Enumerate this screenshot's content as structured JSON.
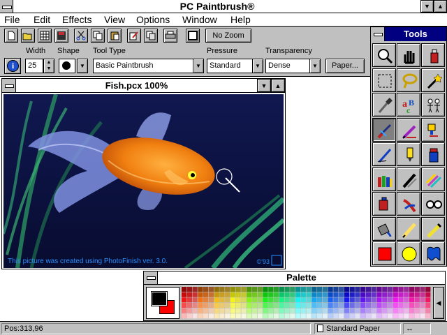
{
  "app": {
    "title": "PC Paintbrush®"
  },
  "menu": [
    "File",
    "Edit",
    "Effects",
    "View",
    "Options",
    "Window",
    "Help"
  ],
  "toolbar": {
    "buttons": [
      "new-icon",
      "open-icon",
      "grid-icon",
      "save-icon",
      "cut-icon",
      "copy-icon",
      "paste-icon",
      "edit-icon",
      "clipboard-icon",
      "print-icon",
      "frame-icon"
    ],
    "zoom_label": "No Zoom"
  },
  "options": {
    "width_label": "Width",
    "width_value": "25",
    "shape_label": "Shape",
    "tooltype_label": "Tool Type",
    "tooltype_value": "Basic Paintbrush",
    "pressure_label": "Pressure",
    "pressure_value": "Standard",
    "transparency_label": "Transparency",
    "transparency_value": "Dense",
    "paper_label": "Paper..."
  },
  "document": {
    "title": "Fish.pcx  100%",
    "credit": "This picture was created using PhotoFinish ver. 3.0.",
    "copyright": "©'93"
  },
  "tools": {
    "title": "Tools",
    "items": [
      "zoom-icon",
      "hand-icon",
      "spray-paint-icon",
      "marquee-icon",
      "lasso-icon",
      "magic-wand-icon",
      "eyedropper-icon",
      "text-icon",
      "clone-icon",
      "paintbrush-icon",
      "pencil-icon",
      "airbrush-icon",
      "pen-icon",
      "highlighter-icon",
      "paint-can-icon",
      "crayons-icon",
      "line-icon",
      "multi-pen-icon",
      "color-replace-icon",
      "smudge-icon",
      "glasses-icon",
      "fill-bucket-icon",
      "chalk-icon",
      "marker-icon",
      "rectangle-icon",
      "ellipse-icon",
      "freeform-shape-icon"
    ]
  },
  "palette": {
    "title": "Palette",
    "foreground": "#000000",
    "background": "#ff0000"
  },
  "status": {
    "position": "Pos:313,96",
    "paper": "Standard Paper",
    "arrow": "↔"
  }
}
